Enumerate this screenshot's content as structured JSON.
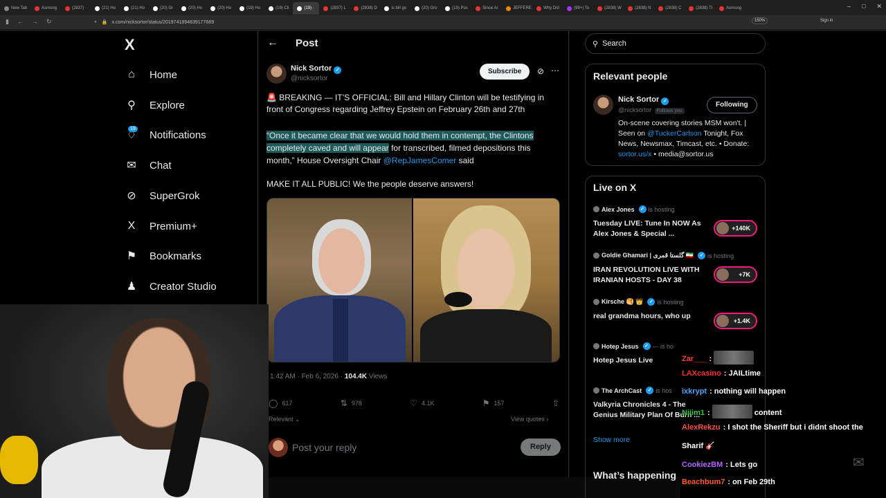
{
  "browser": {
    "tabs": [
      {
        "label": "New Tab",
        "color": "#888"
      },
      {
        "label": "Asmong",
        "color": "#e33"
      },
      {
        "label": "(2837) ·",
        "color": "#e33"
      },
      {
        "label": "(21) Ho",
        "color": "#fff"
      },
      {
        "label": "(21) Ho",
        "color": "#fff"
      },
      {
        "label": "(20) Gr",
        "color": "#fff"
      },
      {
        "label": "(20) Ho",
        "color": "#fff"
      },
      {
        "label": "(20) Ho",
        "color": "#fff"
      },
      {
        "label": "(19) Ho",
        "color": "#fff"
      },
      {
        "label": "(19) Cli",
        "color": "#fff"
      },
      {
        "label": "(19) ·",
        "color": "#fff",
        "active": true
      },
      {
        "label": "(2837) L",
        "color": "#e33"
      },
      {
        "label": "(2838) D",
        "color": "#e33"
      },
      {
        "label": "is bill go",
        "color": "#fff"
      },
      {
        "label": "(20) Gro",
        "color": "#fff"
      },
      {
        "label": "(19) Pos",
        "color": "#fff"
      },
      {
        "label": "Since Ar",
        "color": "#e33"
      },
      {
        "label": "JEFFERE",
        "color": "#e80"
      },
      {
        "label": "Why Did",
        "color": "#e33"
      },
      {
        "label": "(99+) To",
        "color": "#a3f"
      },
      {
        "label": "(2838) W",
        "color": "#e33"
      },
      {
        "label": "(2838) N",
        "color": "#e33"
      },
      {
        "label": "(2838) C",
        "color": "#e33"
      },
      {
        "label": "(2838) Tl",
        "color": "#e33"
      },
      {
        "label": "Asmong",
        "color": "#e33"
      }
    ],
    "url": "x.com/nicksortor/status/2019741894839177689",
    "zoom": "150%",
    "signin": "Sign in"
  },
  "nav": {
    "logo": "X",
    "items": [
      {
        "label": "Home",
        "icon": "⌂"
      },
      {
        "label": "Explore",
        "icon": "⚲"
      },
      {
        "label": "Notifications",
        "icon": "♢"
      },
      {
        "label": "Chat",
        "icon": "✉"
      },
      {
        "label": "SuperGrok",
        "icon": "⊘"
      },
      {
        "label": "Premium+",
        "icon": "X"
      },
      {
        "label": "Bookmarks",
        "icon": "⚑"
      },
      {
        "label": "Creator Studio",
        "icon": "♟"
      }
    ],
    "notif_badge": "19"
  },
  "post": {
    "header_title": "Post",
    "author_name": "Nick Sortor",
    "author_handle": "@nicksortor",
    "subscribe_label": "Subscribe",
    "p1": "🚨 BREAKING — IT’S OFFICIAL: Bill and Hillary Clinton will be testifying in front of Congress regarding Jeffrey Epstein on February 26th and 27th",
    "p2_highlight": "“Once it became clear that we would hold them in contempt, the Clintons completely caved and will appear",
    "p2_rest": " for transcribed, filmed depositions this month,” House Oversight Chair ",
    "p2_mention": "@RepJamesComer",
    "p2_end": " said",
    "p3": "MAKE IT ALL PUBLIC! We the people deserve answers!",
    "time": "1:42 AM · Feb 6, 2026 · ",
    "views_count": "104.4K",
    "views_label": " Views",
    "replies": "617",
    "reposts": "978",
    "likes": "4.1K",
    "bookmarks": "157",
    "relevant_label": "Relevant",
    "view_quotes": "View quotes",
    "reply_placeholder": "Post your reply",
    "reply_button": "Reply"
  },
  "sidebar": {
    "search_placeholder": "Search",
    "relevant_title": "Relevant people",
    "rel_name": "Nick Sortor",
    "rel_handle": "@nicksortor",
    "follows_you": "Follows you",
    "following_label": "Following",
    "bio_1": "On-scene covering stories MSM won't. | Seen on ",
    "bio_mention": "@TuckerCarlson",
    "bio_2": " Tonight, Fox News, Newsmax, Timcast, etc. • Donate: ",
    "bio_link": "sortor.us/x",
    "bio_3": " • media@sortor.us",
    "live_title": "Live on X",
    "live": [
      {
        "host": "Alex Jones",
        "hosting": "is hosting",
        "title": "Tuesday LIVE: Tune In NOW As Alex Jones & Special ...",
        "count": "+140K"
      },
      {
        "host": "Goldie Ghamari | گلستا قمری 🇮🇷",
        "hosting": "is hosting",
        "title": "IRAN REVOLUTION LIVE WITH IRANIAN HOSTS - DAY 38",
        "count": "+7K"
      },
      {
        "host": "Kirsche 🥞 👑",
        "hosting": "is hosting",
        "title": "real grandma hours, who up",
        "count": "+1.4K"
      },
      {
        "host": "Hotep Jesus",
        "hosting": "— is ho",
        "title": "Hotep Jesus Live",
        "count": ""
      },
      {
        "host": "The ArchCast",
        "hosting": "is hos",
        "title": "Valkyria Chronicles 4 - The Genius Military Plan Of Burn ...",
        "count": ""
      }
    ],
    "show_more": "Show more",
    "whats_happening": "What’s happening"
  },
  "chat": [
    {
      "user": "Zar___",
      "color": "#ff3b3b",
      "msg": ":",
      "emote": true
    },
    {
      "user": "LAXcasino",
      "color": "#ff2a2a",
      "msg": ": JAILtime"
    },
    {
      "user": "ixkrypt",
      "color": "#4aa3ff",
      "msg": ": nothing will happen"
    },
    {
      "user": "Niiim1",
      "color": "#2ecc40",
      "msg": ":",
      "emote": true,
      "after": " content"
    },
    {
      "user": "AlexRekzu",
      "color": "#ff4d4d",
      "msg": ": I shot the Sheriff but i didnt shoot the"
    },
    {
      "user": "",
      "color": "#fff",
      "msg": "Sharif 🎸"
    },
    {
      "user": "CookiezBM",
      "color": "#b366ff",
      "msg": ": Lets go"
    },
    {
      "user": "Beachbum7",
      "color": "#ff5a2a",
      "msg": ": on Feb 29th"
    }
  ]
}
